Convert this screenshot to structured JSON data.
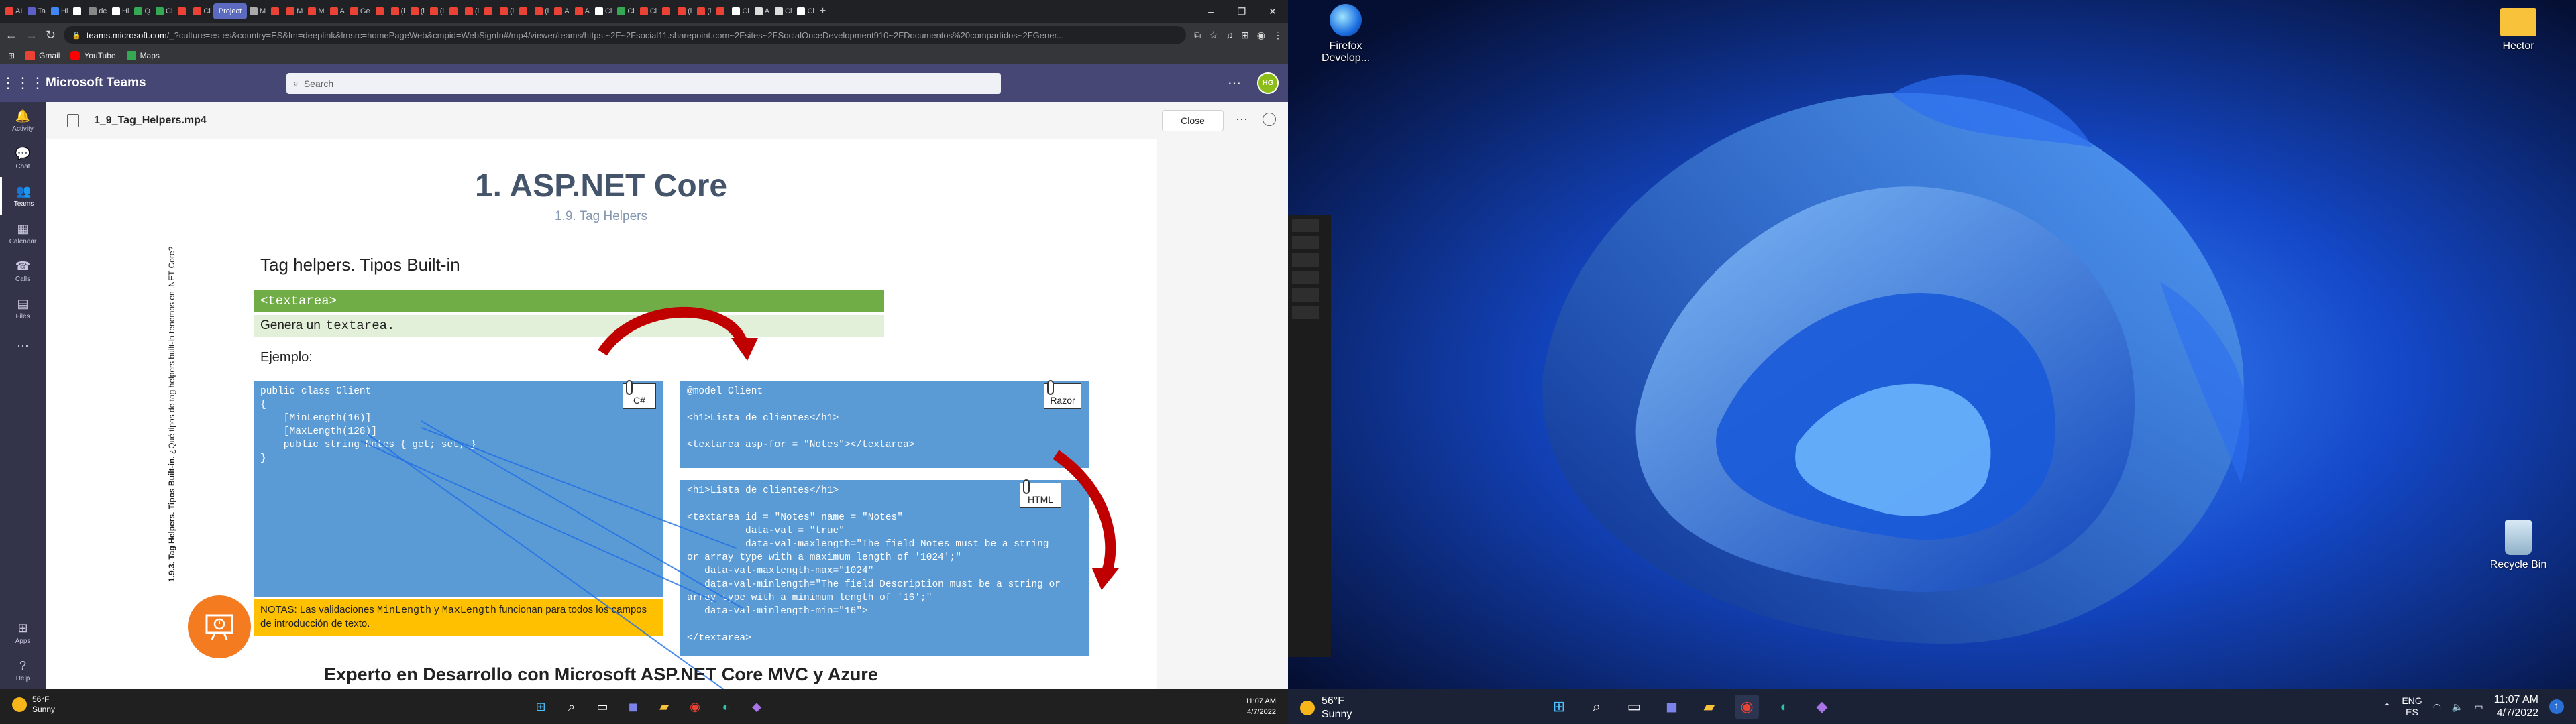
{
  "browser": {
    "tabs": [
      {
        "label": "AI",
        "color": "#ea4335"
      },
      {
        "label": "Ta",
        "color": "#5b5fc7"
      },
      {
        "label": "Hi",
        "color": "#4285f4"
      },
      {
        "label": "",
        "color": "#ffffff"
      },
      {
        "label": "dc",
        "color": "#888888"
      },
      {
        "label": "Hi",
        "color": "#ffffff"
      },
      {
        "label": "Q",
        "color": "#34a853"
      },
      {
        "label": "Ci",
        "color": "#34a853"
      },
      {
        "label": "",
        "color": "#ea4335"
      },
      {
        "label": "Ci",
        "color": "#ea4335"
      },
      {
        "label": "Project",
        "color": "#5c6bc0",
        "active": true
      },
      {
        "label": "M",
        "color": "#aaaaaa"
      },
      {
        "label": "",
        "color": "#ea4335"
      },
      {
        "label": "M",
        "color": "#ea4335"
      },
      {
        "label": "M",
        "color": "#ea4335"
      },
      {
        "label": "A",
        "color": "#ea4335"
      },
      {
        "label": "Ge",
        "color": "#ea4335"
      },
      {
        "label": "",
        "color": "#ea4335"
      },
      {
        "label": "(i",
        "color": "#ea4335"
      },
      {
        "label": "(i",
        "color": "#ea4335"
      },
      {
        "label": "(i",
        "color": "#ea4335"
      },
      {
        "label": "",
        "color": "#ea4335"
      },
      {
        "label": "(i",
        "color": "#ea4335"
      },
      {
        "label": "",
        "color": "#ea4335"
      },
      {
        "label": "(i",
        "color": "#ea4335"
      },
      {
        "label": "",
        "color": "#ea4335"
      },
      {
        "label": "(i",
        "color": "#ea4335"
      },
      {
        "label": "A",
        "color": "#ea4335"
      },
      {
        "label": "A",
        "color": "#ea4335"
      },
      {
        "label": "Ci",
        "color": "#ffffff"
      },
      {
        "label": "Ci",
        "color": "#34a853"
      },
      {
        "label": "Ci",
        "color": "#ea4335"
      },
      {
        "label": "",
        "color": "#ea4335"
      },
      {
        "label": "(i",
        "color": "#ea4335"
      },
      {
        "label": "(i",
        "color": "#ea4335"
      },
      {
        "label": "",
        "color": "#ea4335"
      },
      {
        "label": "Ci",
        "color": "#ffffff"
      },
      {
        "label": "A",
        "color": "#dddddd"
      },
      {
        "label": "Ci",
        "color": "#dddddd"
      },
      {
        "label": "Ci",
        "color": "#ffffff"
      }
    ],
    "new_tab": "+",
    "url_host": "teams.microsoft.com",
    "url_path": "/_?culture=es-es&country=ES&lm=deeplink&lmsrc=homePageWeb&cmpid=WebSignIn#/mp4/viewer/teams/https:~2F~2Fsocial11.sharepoint.com~2Fsites~2FSocialOnceDevelopment910~2FDocumentos%20compartidos~2FGener...",
    "bookmarks": [
      {
        "label": "Gmail",
        "color": "#ea4335"
      },
      {
        "label": "YouTube",
        "color": "#ff0000"
      },
      {
        "label": "Maps",
        "color": "#34a853"
      }
    ]
  },
  "teams": {
    "app_name": "Microsoft Teams",
    "search_placeholder": "Search",
    "avatar_initials": "HG",
    "rail": [
      {
        "label": "Activity",
        "icon": "bell-icon"
      },
      {
        "label": "Chat",
        "icon": "chat-icon"
      },
      {
        "label": "Teams",
        "icon": "teams-icon",
        "active": true
      },
      {
        "label": "Calendar",
        "icon": "calendar-icon"
      },
      {
        "label": "Calls",
        "icon": "phone-icon"
      },
      {
        "label": "Files",
        "icon": "file-icon"
      },
      {
        "label": "...",
        "icon": "more-icon"
      }
    ],
    "rail_bottom": [
      {
        "label": "Apps",
        "icon": "apps-icon"
      },
      {
        "label": "Help",
        "icon": "help-icon"
      }
    ],
    "file_name": "1_9_Tag_Helpers.mp4",
    "close_label": "Close"
  },
  "slide": {
    "title": "1. ASP.NET Core",
    "subtitle": "1.9. Tag Helpers",
    "side_bold": "1.9.3. Tag Helpers. Tipos Built-in.",
    "side_rest": " ¿Qué tipos de tag helpers built-in tenemos en .NET Core?",
    "heading": "Tag helpers. Tipos Built-in",
    "green_bar": "<textarea>",
    "light_bar_text": "Genera un",
    "light_bar_code": "textarea.",
    "example_label": "Ejemplo:",
    "code_cs": "public class Client\n{\n    [MinLength(16)]\n    [MaxLength(128)]\n    public string Notes { get; set; }\n}",
    "code_razor": "@model Client\n\n<h1>Lista de clientes</h1>\n\n<textarea asp-for = \"Notes\"></textarea>",
    "code_html": "<h1>Lista de clientes</h1>\n\n<textarea id = \"Notes\" name = \"Notes\"\n          data-val = \"true\"\n          data-val-maxlength=\"The field Notes must be a string\nor array type with a maximum length of '1024';\"\n   data-val-maxlength-max=\"1024\"\n   data-val-minlength=\"The field Description must be a string or\narray type with a minimum length of '16';\"\n   data-val-minlength-min=\"16\">\n\n</textarea>",
    "tag_cs": "C#",
    "tag_razor": "Razor",
    "tag_html": "HTML",
    "note_prefix": "NOTAS: Las validaciones ",
    "note_code1": "MinLength",
    "note_mid": " y ",
    "note_code2": "MaxLength",
    "note_suffix": " funcionan para todos los campos de introducción de texto.",
    "footer": "Experto en Desarrollo con Microsoft ASP.NET Core MVC y Azure"
  },
  "taskbar1": {
    "temp": "56°F",
    "cond": "Sunny",
    "time": "11:07 AM",
    "date": "4/7/2022"
  },
  "desktop": {
    "icons": [
      {
        "label": "Firefox Develop...",
        "icon": "firefox-developer-icon"
      },
      {
        "label": "Hector",
        "icon": "folder-icon"
      },
      {
        "label": "Recycle Bin",
        "icon": "recycle-bin-icon"
      }
    ],
    "temp": "56°F",
    "cond": "Sunny",
    "lang1": "ENG",
    "lang2": "ES",
    "time": "11:07 AM",
    "date": "4/7/2022",
    "notif_count": "1"
  }
}
